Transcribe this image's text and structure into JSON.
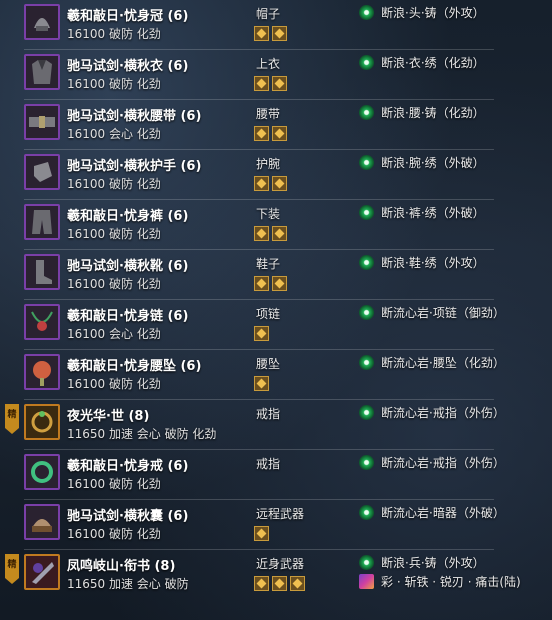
{
  "items": [
    {
      "name": "羲和敲日·忧身冠 (6)",
      "stats": "16100 破防 化劲",
      "slot": "帽子",
      "gems": 2,
      "enchant": "断浪·头·铸（外攻）",
      "badge": "",
      "thumb_icon": "helmet-icon"
    },
    {
      "name": "驰马试剑·横秋衣 (6)",
      "stats": "16100 破防 化劲",
      "slot": "上衣",
      "gems": 2,
      "enchant": "断浪·衣·绣（化劲）",
      "badge": "",
      "thumb_icon": "chest-armor-icon"
    },
    {
      "name": "驰马试剑·横秋腰带 (6)",
      "stats": "16100 会心 化劲",
      "slot": "腰带",
      "gems": 2,
      "enchant": "断浪·腰·铸（化劲）",
      "badge": "",
      "thumb_icon": "belt-icon"
    },
    {
      "name": "驰马试剑·横秋护手 (6)",
      "stats": "16100 破防 化劲",
      "slot": "护腕",
      "gems": 2,
      "enchant": "断浪·腕·绣（外破）",
      "badge": "",
      "thumb_icon": "gauntlet-icon"
    },
    {
      "name": "羲和敲日·忧身裤 (6)",
      "stats": "16100 破防 化劲",
      "slot": "下装",
      "gems": 2,
      "enchant": "断浪·裤·绣（外破）",
      "badge": "",
      "thumb_icon": "pants-icon"
    },
    {
      "name": "驰马试剑·横秋靴 (6)",
      "stats": "16100 破防 化劲",
      "slot": "鞋子",
      "gems": 2,
      "enchant": "断浪·鞋·绣（外攻）",
      "badge": "",
      "thumb_icon": "boots-icon"
    },
    {
      "name": "羲和敲日·忧身链 (6)",
      "stats": "16100 会心 化劲",
      "slot": "项链",
      "gems": 1,
      "enchant": "断流心岩·项链（御劲）",
      "badge": "",
      "thumb_icon": "necklace-icon"
    },
    {
      "name": "羲和敲日·忧身腰坠 (6)",
      "stats": "16100 破防 化劲",
      "slot": "腰坠",
      "gems": 1,
      "enchant": "断流心岩·腰坠（化劲）",
      "badge": "",
      "thumb_icon": "pendant-icon"
    },
    {
      "name": "夜光华·世 (8)",
      "stats": "11650 加速 会心 破防 化劲",
      "slot": "戒指",
      "gems": 0,
      "enchant": "断流心岩·戒指（外伤）",
      "badge": "精",
      "thumb_icon": "ring-orange-icon"
    },
    {
      "name": "羲和敲日·忧身戒 (6)",
      "stats": "16100 破防 化劲",
      "slot": "戒指",
      "gems": 0,
      "enchant": "断流心岩·戒指（外伤）",
      "badge": "",
      "thumb_icon": "ring-icon"
    },
    {
      "name": "驰马试剑·横秋囊 (6)",
      "stats": "16100 破防 化劲",
      "slot": "远程武器",
      "gems": 1,
      "enchant": "断流心岩·暗器（外破）",
      "badge": "",
      "thumb_icon": "quiver-icon"
    },
    {
      "name": "凤鸣岐山·衔书 (8)",
      "stats": "11650 加速 会心 破防",
      "slot": "近身武器",
      "gems": 3,
      "enchant": "断浪·兵·铸（外攻）",
      "enchant2": "彩 · 斩铁 · 锐刃 · 痛击(陆)",
      "badge": "精",
      "thumb_icon": "weapon-icon"
    }
  ],
  "colors": {
    "epic_border": "#7a3fa8",
    "legend_border": "#c07a20",
    "gem": "#f0c050",
    "enchant": "#1fae55"
  }
}
